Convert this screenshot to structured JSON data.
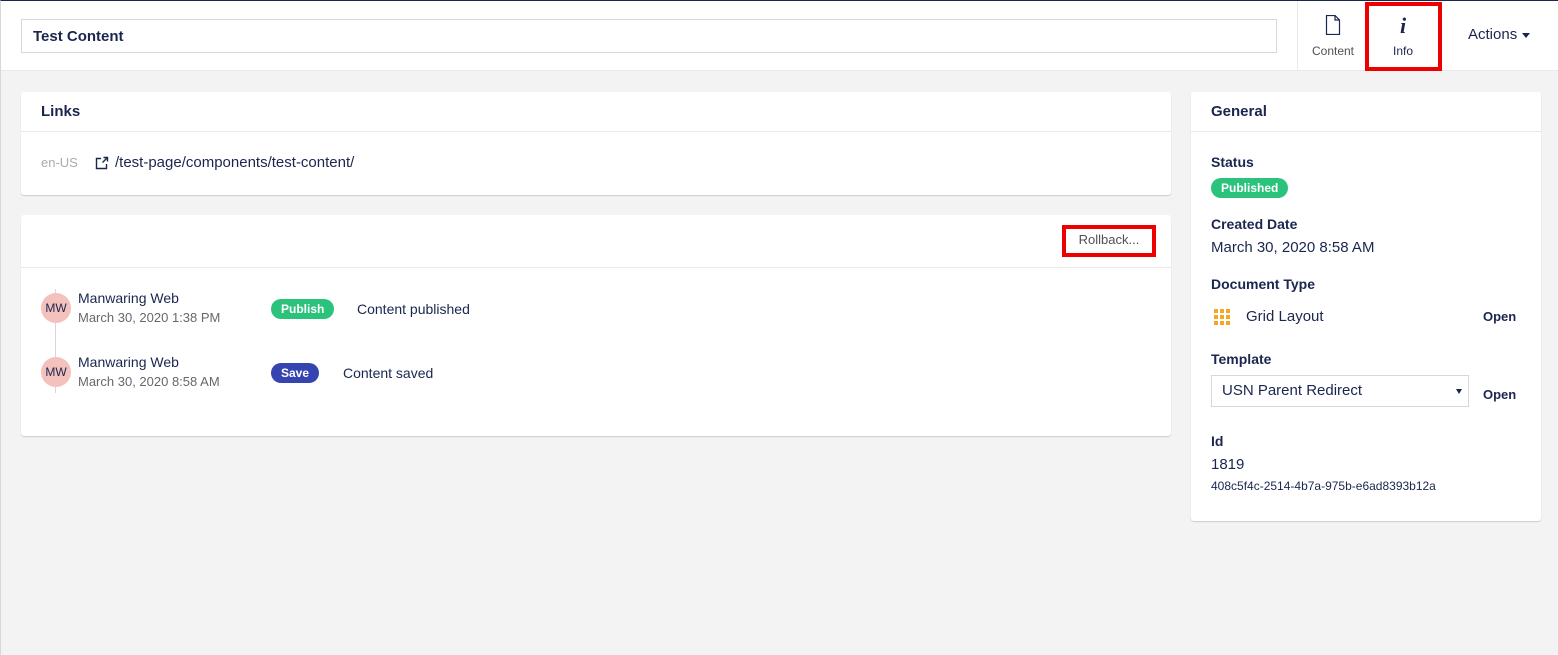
{
  "header": {
    "name_value": "Test Content",
    "tabs": [
      {
        "label": "Content",
        "icon": "document-icon"
      },
      {
        "label": "Info",
        "icon": "info-icon"
      }
    ],
    "actions_label": "Actions"
  },
  "links": {
    "title": "Links",
    "culture": "en-US",
    "url": "/test-page/components/test-content/"
  },
  "history": {
    "rollback_label": "Rollback...",
    "items": [
      {
        "initials": "MW",
        "user": "Manwaring Web",
        "date": "March 30, 2020 1:38 PM",
        "badge": "Publish",
        "message": "Content published"
      },
      {
        "initials": "MW",
        "user": "Manwaring Web",
        "date": "March 30, 2020 8:58 AM",
        "badge": "Save",
        "message": "Content saved"
      }
    ]
  },
  "general": {
    "title": "General",
    "status_label": "Status",
    "status_value": "Published",
    "created_label": "Created Date",
    "created_value": "March 30, 2020 8:58 AM",
    "doctype_label": "Document Type",
    "doctype_value": "Grid Layout",
    "doctype_icon": "grid-icon",
    "open_label": "Open",
    "template_label": "Template",
    "template_value": "USN Parent Redirect",
    "id_label": "Id",
    "id_value": "1819",
    "guid_value": "408c5f4c-2514-4b7a-975b-e6ad8393b12a"
  },
  "colors": {
    "primary": "#1b264f",
    "publish_badge": "#2bc37c",
    "save_badge": "#3544b1",
    "avatar": "#f5c1bc",
    "highlight": "#ee0000",
    "grid_icon": "#f5a623"
  }
}
